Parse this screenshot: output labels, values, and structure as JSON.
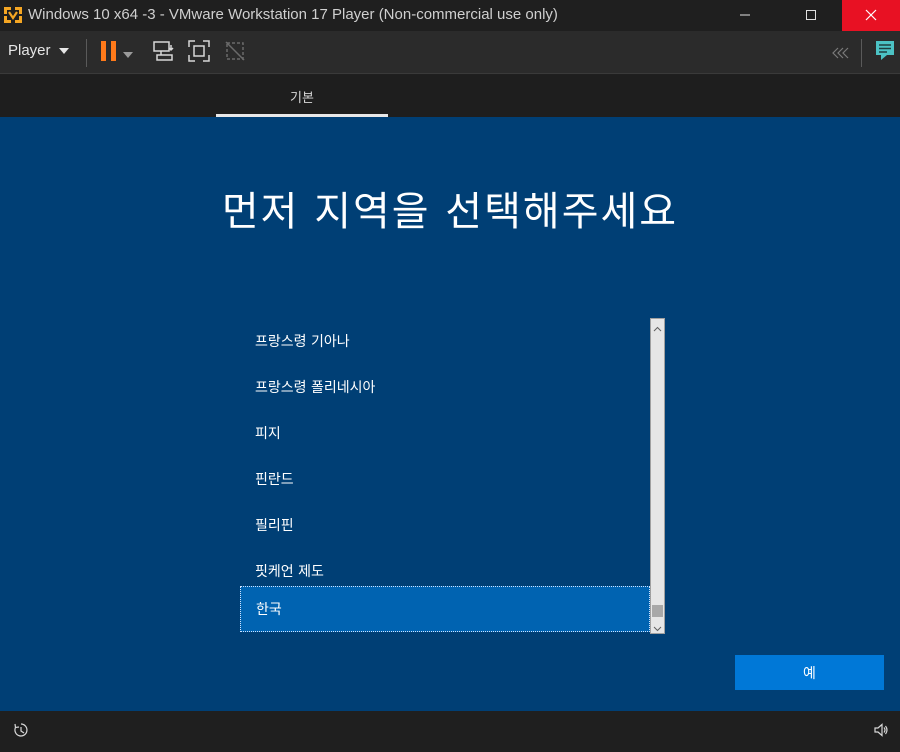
{
  "window": {
    "title": "Windows 10 x64 -3 - VMware Workstation 17 Player (Non-commercial use only)",
    "app_icon": "vmware-icon",
    "controls": [
      "minimize-icon",
      "maximize-icon",
      "close-icon"
    ]
  },
  "toolbar": {
    "player_label": "Player",
    "icons": [
      "pause-icon",
      "dropdown-arrow-icon",
      "send-ctrl-alt-del-icon",
      "fullscreen-icon",
      "unity-icon",
      "collapse-chevrons-icon",
      "message-log-icon"
    ]
  },
  "oobe": {
    "tab_label": "기본",
    "heading": "먼저 지역을 선택해주세요",
    "regions": [
      "프랑스령 기아나",
      "프랑스령 폴리네시아",
      "피지",
      "핀란드",
      "필리핀",
      "핏케언 제도",
      "한국"
    ],
    "selected_index": 6,
    "confirm_label": "예"
  },
  "statusbar": {
    "icons": [
      "ease-of-access-icon",
      "volume-icon"
    ]
  },
  "colors": {
    "oobe_background": "#003f75",
    "selected_item": "#0063b1",
    "button": "#0078d7",
    "close_button": "#e81123",
    "pause_orange": "#ff7a1a",
    "message_icon": "#4cc2c4"
  }
}
